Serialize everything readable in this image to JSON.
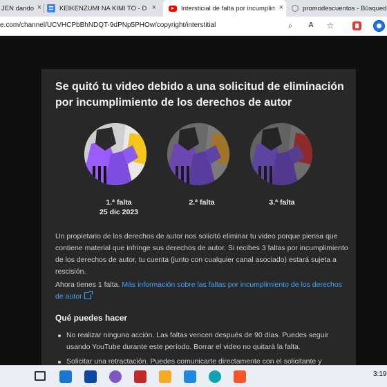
{
  "browser": {
    "tabs": [
      {
        "title": "JEN dando"
      },
      {
        "title": "KEIKENZUMI NA KIMI TO - Docu"
      },
      {
        "title": "Intersticial de falta por incumplim"
      },
      {
        "title": "promodescuentos - Búsqueda"
      }
    ],
    "url": "e.com/channel/UCVHCPbBhNDQT-9dPNp5PHOw/copyright/interstitial"
  },
  "dialog": {
    "title": "Se quitó tu video debido a una solicitud de eliminación por incumplimiento de los derechos de autor",
    "strikes": [
      {
        "label": "1.ª falta",
        "date": "25 dic 2023"
      },
      {
        "label": "2.ª falta",
        "date": ""
      },
      {
        "label": "3.ª falta",
        "date": ""
      }
    ],
    "paragraph": "Un propietario de los derechos de autor nos solicitó eliminar tu video porque piensa que contiene material que infringe sus derechos de autor. Si recibes 3 faltas por incumplimiento de los derechos de autor, tu cuenta (junto con cualquier canal asociado) estará sujeta a rescisión.",
    "current_strikes": "Ahora tienes 1 falta.",
    "learn_more_link": "Más información sobre las faltas por incumplimiento de los derechos de autor",
    "what_you_can_do_heading": "Qué puedes hacer",
    "options": [
      "No realizar ninguna acción. Las faltas vencen después de 90 días. Puedes seguir usando YouTube durante este período. Borrar el video no quitará la falta.",
      "Solicitar una retractación. Puedes comunicarte directamente con el solicitante y"
    ]
  },
  "taskbar": {
    "time": "3:19"
  },
  "colors": {
    "accent_link": "#3ea6ff",
    "card_yellow": "#f5c518",
    "card_red": "#c62828",
    "figure_purple": "#9a5cff"
  }
}
